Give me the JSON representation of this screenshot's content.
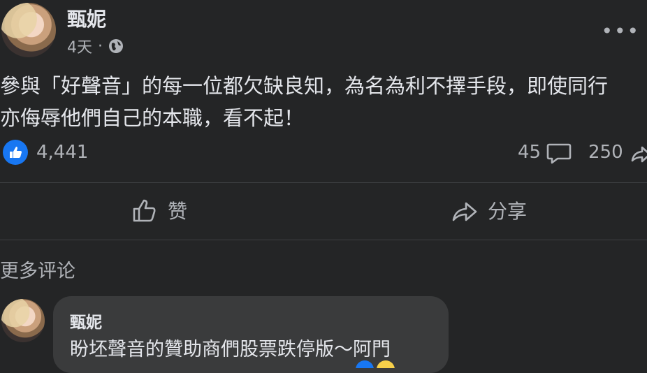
{
  "post": {
    "author": "甄妮",
    "time": "4天",
    "separator": "·",
    "text": "參與「好聲音」的每一位都欠缺良知，為名為利不擇手段，即使同行\n亦侮辱他們自己的本職，看不起！"
  },
  "stats": {
    "likes": "4,441",
    "comments": "45",
    "shares": "250"
  },
  "actions": {
    "like_label": "赞",
    "share_label": "分享"
  },
  "comments_section": {
    "more_label": "更多评论",
    "comment": {
      "author": "甄妮",
      "text": "盼坯聲音的贊助商們股票跌停版～阿門"
    }
  },
  "colors": {
    "background": "#242526",
    "bubble": "#3a3b3c",
    "like_blue": "#1877f2",
    "secondary_text": "#b0b3b8"
  }
}
